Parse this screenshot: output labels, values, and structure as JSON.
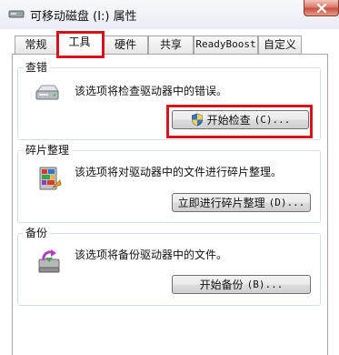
{
  "window": {
    "title": "可移动磁盘 (I:) 属性",
    "icon": "removable-drive-icon",
    "close_icon": "close-icon"
  },
  "tabs": [
    {
      "label": "常规",
      "active": false
    },
    {
      "label": "工具",
      "active": true
    },
    {
      "label": "硬件",
      "active": false
    },
    {
      "label": "共享",
      "active": false
    },
    {
      "label": "ReadyBoost",
      "active": false
    },
    {
      "label": "自定义",
      "active": false
    }
  ],
  "sections": {
    "check": {
      "title": "查错",
      "icon": "drive-check-icon",
      "description": "该选项将检查驱动器中的错误。",
      "button_label": "开始检查",
      "button_shortcut": "(C)...",
      "button_icon": "uac-shield-icon"
    },
    "defrag": {
      "title": "碎片整理",
      "icon": "defrag-icon",
      "description": "该选项将对驱动器中的文件进行碎片整理。",
      "button_label": "立即进行碎片整理",
      "button_shortcut": "(D)..."
    },
    "backup": {
      "title": "备份",
      "icon": "backup-icon",
      "description": "该选项将备份驱动器中的文件。",
      "button_label": "开始备份",
      "button_shortcut": "(B)..."
    }
  },
  "colors": {
    "highlight": "#d4141c",
    "group_border": "#d5dfe5",
    "tab_border": "#a6a6a6"
  }
}
